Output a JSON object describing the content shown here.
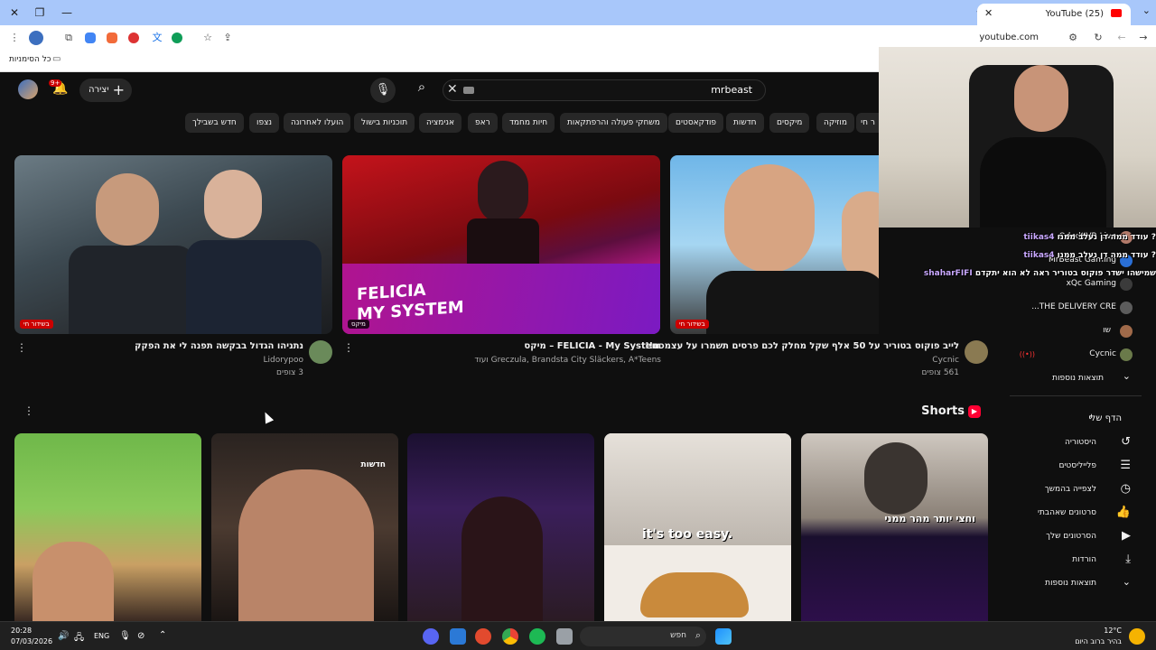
{
  "browser": {
    "tab_title": "(25) YouTube",
    "url": "youtube.com",
    "bookmarks_label": "כל הסימניות"
  },
  "youtube": {
    "search_query": "mrbeast",
    "create_label": "יצירה",
    "notif_count": "9+",
    "chips": [
      "ר חי",
      "מוזיקה",
      "מיקסים",
      "חדשות",
      "פודקאסטים",
      "משחקי פעולה והרפתקאות",
      "חיות מחמד",
      "ראפ",
      "אנימציה",
      "תוכניות בישול",
      "הועלו לאחרונה",
      "נצפו",
      "חדש בשבילך"
    ],
    "videos": [
      {
        "title": "נתניהו הגדול בבקשה תפנה לי את הפקק",
        "channel": "Lidorypoo",
        "meta": "3 צופים",
        "badge": "בשידור חי"
      },
      {
        "title": "FELICIA - My System – מיקס",
        "channel": "Greczula, Brandsta City Släckers, A*Teens ועוד",
        "meta": "",
        "badge": "מיקס",
        "thumb_text": "FELICIA\nMY SYSTEM"
      },
      {
        "title": "לייב פוקוס בטוריר על 50 אלף שקל מחלק לכם פרסים תשמרו על עצמכם!!",
        "channel": "Cycnic",
        "meta": "561 צופים",
        "badge": "בשידור חי"
      }
    ],
    "shorts_label": "Shorts",
    "shorts": [
      {
        "overlay": ""
      },
      {
        "overlay": "חדשות"
      },
      {
        "overlay": ""
      },
      {
        "overlay": "it's too easy."
      },
      {
        "overlay": "וחצי יותר מהר ממני"
      }
    ]
  },
  "sidebar": {
    "subs": [
      "OdedSVR Live",
      "MrBeast Gaming",
      "xQc Gaming",
      "THE DELIVERY CRE...",
      "שו",
      "Cycnic"
    ],
    "more1": "תוצאות נוספות",
    "you_header": "הדף שלי",
    "you_items": [
      "היסטוריה",
      "פלייליסטים",
      "לצפייה בהמשך",
      "סרטונים שאהבתי",
      "הסרטונים שלך",
      "הורדות",
      "תוצאות נוספות"
    ]
  },
  "chat": [
    {
      "nick": "tiikas4",
      "text": "? עודד ממה דן נעלב ממנו"
    },
    {
      "nick": "tiikas4",
      "text": "? עודד ממה דן נעלב ממנו"
    },
    {
      "nick": "shaharFIFI",
      "text": "שמישהו ישדר פוקוס בטוריר ראה לא הוא יתקדם"
    }
  ],
  "taskbar": {
    "time": "20:28",
    "date": "07/03/2026",
    "lang": "ENG",
    "search_placeholder": "חפש",
    "weather_temp": "12°C",
    "weather_desc": "בהיר ברוב היום"
  }
}
